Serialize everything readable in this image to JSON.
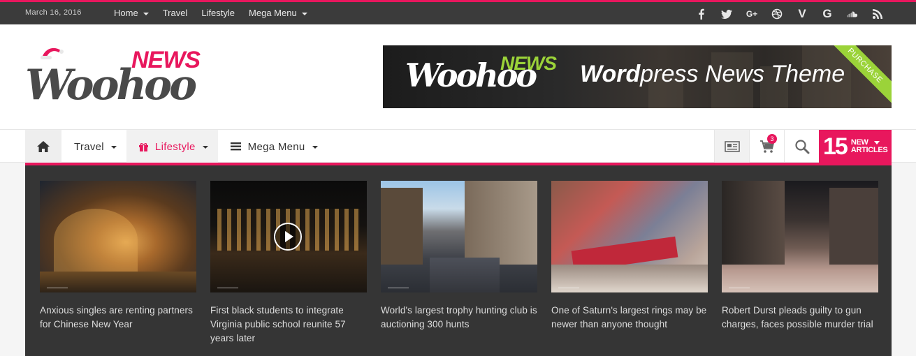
{
  "topbar": {
    "date": "March 16, 2016",
    "nav": [
      {
        "label": "Home",
        "has_dropdown": true
      },
      {
        "label": "Travel",
        "has_dropdown": false
      },
      {
        "label": "Lifestyle",
        "has_dropdown": false
      },
      {
        "label": "Mega Menu",
        "has_dropdown": true
      }
    ],
    "social": [
      "facebook-icon",
      "twitter-icon",
      "google-plus-icon",
      "dribbble-icon",
      "vimeo-icon",
      "google-icon",
      "soundcloud-icon",
      "rss-icon"
    ]
  },
  "header": {
    "logo_script": "Woohoo",
    "logo_news": "NEWS",
    "banner": {
      "script": "Woohoo",
      "news": "NEWS",
      "tagline_bold": "Word",
      "tagline_rest": "press News Theme",
      "ribbon": "PURCHASE"
    }
  },
  "mainnav": {
    "items": [
      {
        "label": "Travel",
        "active": false
      },
      {
        "label": "Lifestyle",
        "active": true
      },
      {
        "label": "Mega Menu",
        "active": false
      }
    ],
    "cart_count": "3",
    "new_articles_count": "15",
    "new_articles_line1": "NEW",
    "new_articles_line2": "ARTICLES"
  },
  "mega": {
    "posts": [
      {
        "title": "Anxious singles are renting partners for Chinese New Year",
        "video": false
      },
      {
        "title": "First black students to integrate Virginia public school reunite 57 years later",
        "video": true
      },
      {
        "title": "World's largest trophy hunting club is auctioning 300 hunts",
        "video": false
      },
      {
        "title": "One of Saturn's largest rings may be newer than anyone thought",
        "video": false
      },
      {
        "title": "Robert Durst pleads guilty to gun charges, faces possible murder trial",
        "video": false
      }
    ]
  },
  "colors": {
    "accent": "#e8175d",
    "topbar": "#3b3b3b",
    "mega_bg": "#353535",
    "banner_green": "#9bd339"
  }
}
